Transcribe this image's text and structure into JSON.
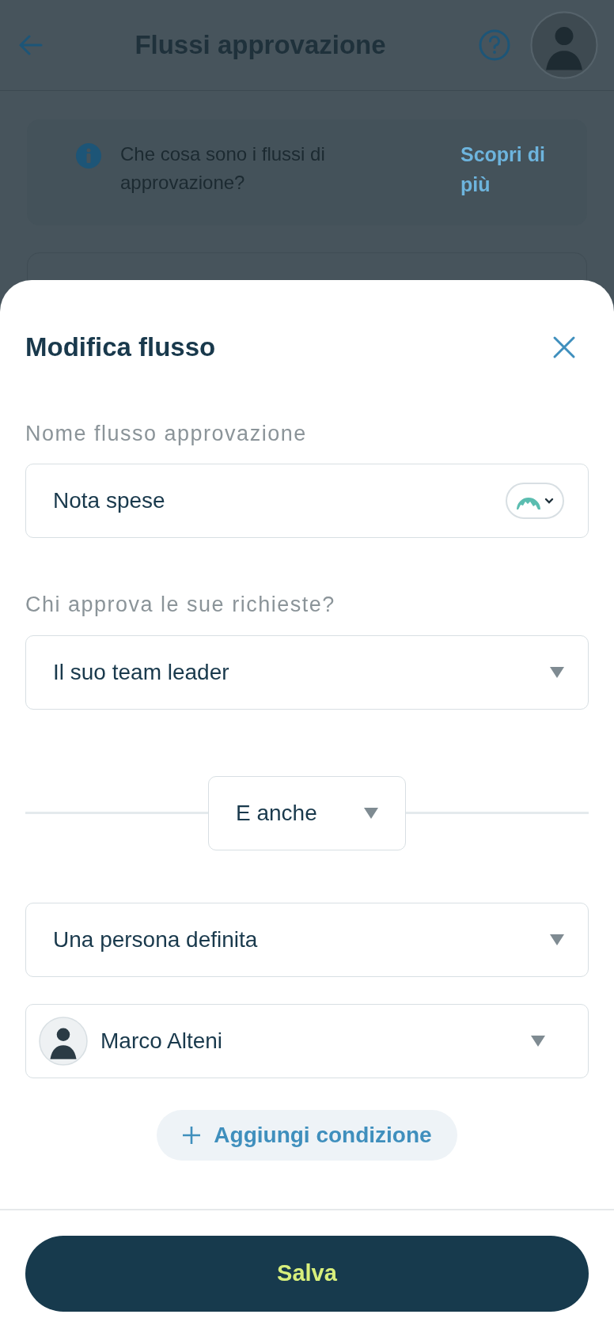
{
  "background": {
    "title": "Flussi approvazione",
    "info": {
      "text": "Che cosa sono i flussi di approvazione?",
      "link": "Scopri di più"
    }
  },
  "sheet": {
    "title": "Modifica flusso",
    "name_field": {
      "label": "Nome flusso approvazione",
      "value": "Nota spese"
    },
    "approver_field": {
      "label": "Chi approva le sue richieste?",
      "value": "Il suo team leader"
    },
    "connector": {
      "value": "E anche"
    },
    "conditions": [
      {
        "kind": "select",
        "value": "Una persona definita"
      },
      {
        "kind": "person",
        "value": "Marco Alteni"
      }
    ],
    "add_button": "Aggiungi condizione",
    "save_button": "Salva"
  }
}
